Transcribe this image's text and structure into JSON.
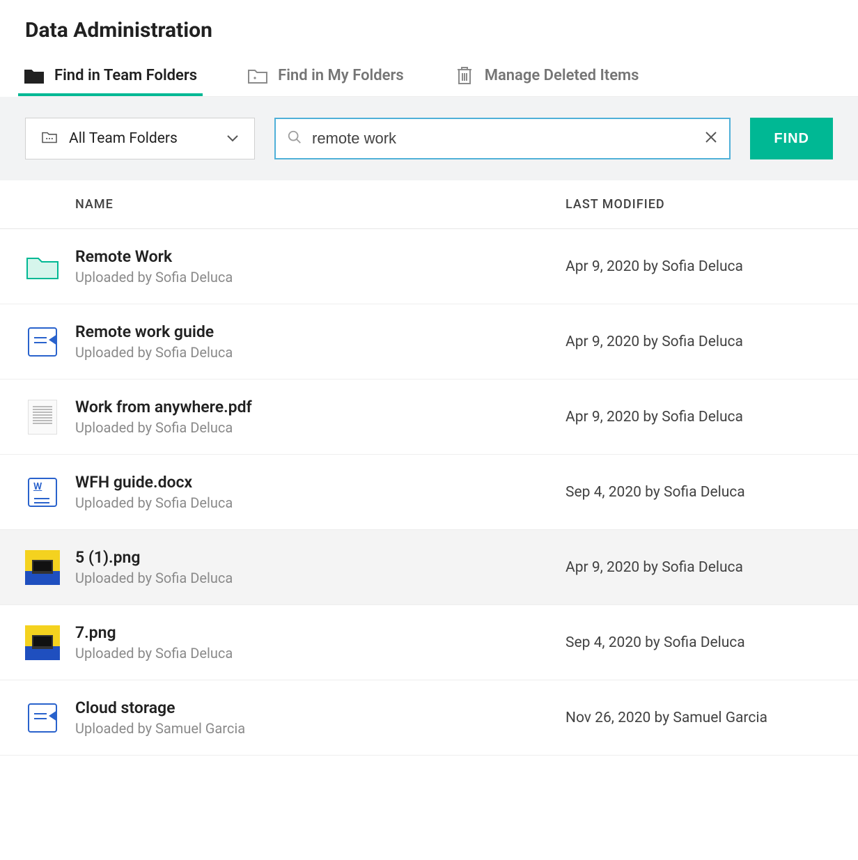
{
  "page_title": "Data Administration",
  "tabs": [
    {
      "label": "Find in Team Folders",
      "icon": "team-folder-icon",
      "active": true
    },
    {
      "label": "Find in My Folders",
      "icon": "my-folder-icon",
      "active": false
    },
    {
      "label": "Manage Deleted Items",
      "icon": "trash-icon",
      "active": false
    }
  ],
  "folder_select": {
    "label": "All Team Folders"
  },
  "search": {
    "value": "remote work",
    "placeholder": ""
  },
  "find_button_label": "FIND",
  "columns": {
    "name": "NAME",
    "last_modified": "LAST MODIFIED"
  },
  "rows": [
    {
      "icon": "folder",
      "title": "Remote Work",
      "sub": "Uploaded by Sofia Deluca",
      "modified": "Apr 9, 2020 by Sofia Deluca",
      "highlight": false
    },
    {
      "icon": "doc",
      "title": "Remote work guide",
      "sub": "Uploaded by Sofia Deluca",
      "modified": "Apr 9, 2020 by Sofia Deluca",
      "highlight": false
    },
    {
      "icon": "pdf",
      "title": "Work from anywhere.pdf",
      "sub": "Uploaded by Sofia Deluca",
      "modified": "Apr 9, 2020 by Sofia Deluca",
      "highlight": false
    },
    {
      "icon": "word",
      "title": "WFH guide.docx",
      "sub": "Uploaded by Sofia Deluca",
      "modified": "Sep 4, 2020 by Sofia Deluca",
      "highlight": false
    },
    {
      "icon": "image",
      "title": "5 (1).png",
      "sub": "Uploaded by Sofia Deluca",
      "modified": "Apr 9, 2020 by Sofia Deluca",
      "highlight": true
    },
    {
      "icon": "image",
      "title": "7.png",
      "sub": "Uploaded by Sofia Deluca",
      "modified": "Sep 4, 2020 by Sofia Deluca",
      "highlight": false
    },
    {
      "icon": "doc",
      "title": "Cloud storage",
      "sub": "Uploaded by Samuel Garcia",
      "modified": "Nov 26, 2020 by Samuel Garcia",
      "highlight": false
    }
  ]
}
